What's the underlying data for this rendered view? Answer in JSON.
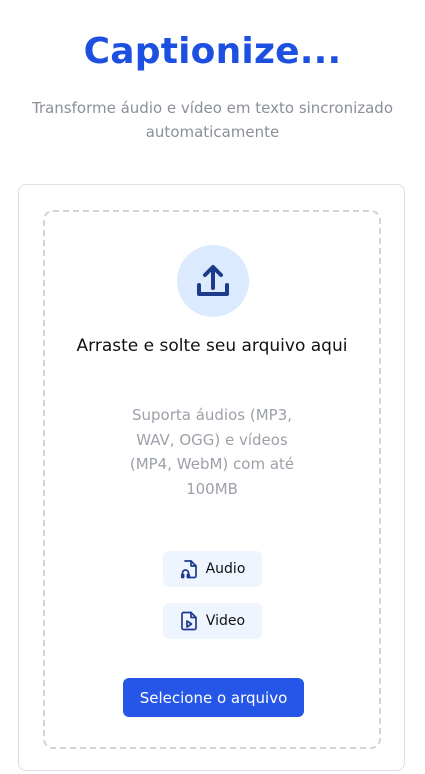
{
  "header": {
    "title": "Captionize...",
    "subtitle": "Transforme áudio e vídeo em texto sincronizado automaticamente"
  },
  "dropzone": {
    "icon": "upload-icon",
    "title": "Arraste e solte seu arquivo aqui",
    "description": "Suporta áudios (MP3, WAV, OGG) e vídeos (MP4, WebM) com até 100MB"
  },
  "file_types": [
    {
      "label": "Audio",
      "icon": "audio-file-icon"
    },
    {
      "label": "Video",
      "icon": "video-file-icon"
    }
  ],
  "select_button": {
    "label": "Selecione o arquivo"
  },
  "colors": {
    "brand": "#1d4fe0",
    "button": "#2556e8",
    "icon_circle": "#dbeafe",
    "chip": "#eef5ff"
  }
}
